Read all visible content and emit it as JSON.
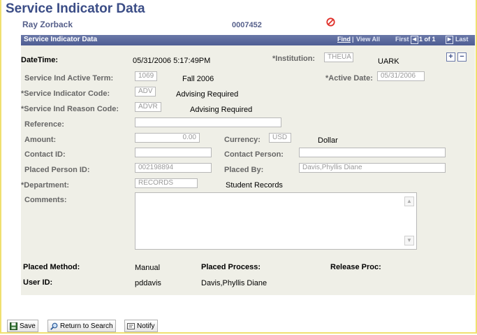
{
  "header": {
    "title": "Service Indicator Data",
    "person_name": "Ray Zorback",
    "person_id": "0007452"
  },
  "panel": {
    "title": "Service Indicator Data",
    "nav": {
      "find": "Find",
      "separator": "|",
      "view_all": "View All",
      "first": "First",
      "count": "1 of 1",
      "last": "Last"
    }
  },
  "fields": {
    "datetime_label": "DateTime:",
    "datetime_value": "05/31/2006  5:17:49PM",
    "institution_label": "*Institution:",
    "institution_value": "THEUA",
    "institution_desc": "UARK",
    "active_term_label": "Service Ind Active Term:",
    "active_term_value": "1069",
    "active_term_desc": "Fall 2006",
    "active_date_label": "*Active Date:",
    "active_date_value": "05/31/2006",
    "indicator_code_label": "*Service Indicator Code:",
    "indicator_code_value": "ADV",
    "indicator_code_desc": "Advising Required",
    "reason_code_label": "*Service Ind Reason Code:",
    "reason_code_value": "ADVR",
    "reason_code_desc": "Advising Required",
    "reference_label": "Reference:",
    "reference_value": "",
    "amount_label": "Amount:",
    "amount_value": "0.00",
    "currency_label": "Currency:",
    "currency_value": "USD",
    "currency_desc": "Dollar",
    "contact_id_label": "Contact ID:",
    "contact_id_value": "",
    "contact_person_label": "Contact Person:",
    "contact_person_value": "",
    "placed_person_label": "Placed Person ID:",
    "placed_person_value": "002198894",
    "placed_by_label": "Placed By:",
    "placed_by_value": "Davis,Phyllis Diane",
    "department_label": "*Department:",
    "department_value": "RECORDS",
    "department_desc": "Student Records",
    "comments_label": "Comments:",
    "comments_value": "",
    "placed_method_label": "Placed Method:",
    "placed_method_value": "Manual",
    "placed_process_label": "Placed Process:",
    "placed_process_value": "",
    "release_proc_label": "Release Proc:",
    "release_proc_value": "",
    "user_id_label": "User ID:",
    "user_id_value": "pddavis",
    "user_name_value": "Davis,Phyllis Diane"
  },
  "toolbar": {
    "save_label": "Save",
    "return_label": "Return to Search",
    "notify_label": "Notify"
  },
  "icons": {
    "no_entry": "no-entry-icon",
    "add_row": "plus-icon",
    "delete_row": "minus-icon",
    "save": "floppy-disk-icon",
    "return": "magnifier-icon",
    "notify": "notepad-icon"
  },
  "colors": {
    "title": "#3b4d86",
    "panel_header": "#4e5d93",
    "panel_bg": "#efefe7",
    "frame_border": "#f0e070",
    "alert": "#e0302a"
  }
}
